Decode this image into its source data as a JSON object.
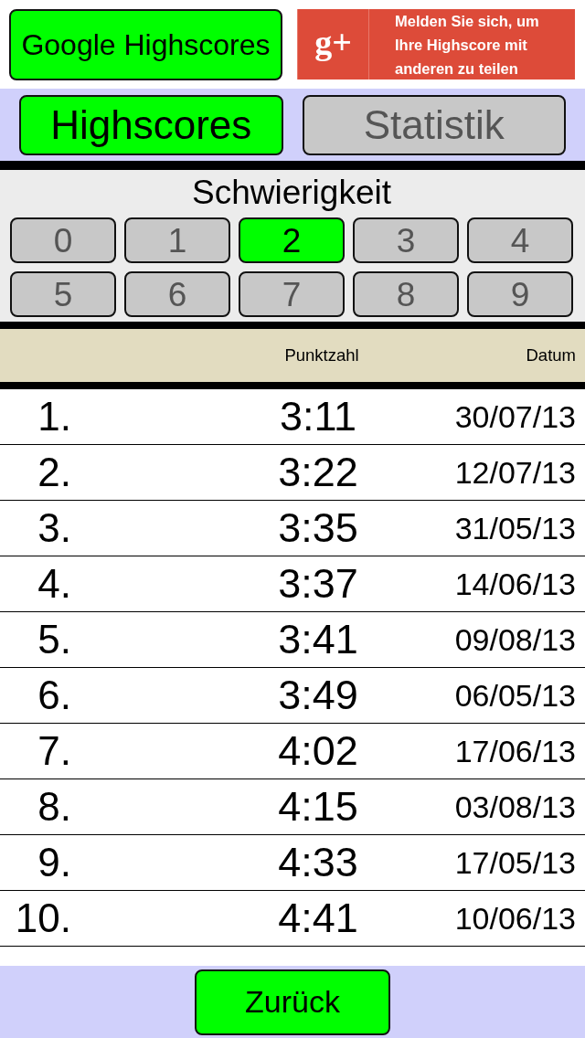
{
  "top_bar": {
    "google_button": "Google Highscores",
    "signin_banner": {
      "logo": "g+",
      "text": "Melden Sie sich, um Ihre Highscore mit anderen zu teilen"
    }
  },
  "tabs": [
    {
      "label": "Highscores",
      "selected": true
    },
    {
      "label": "Statistik",
      "selected": false
    }
  ],
  "difficulty": {
    "title": "Schwierigkeit",
    "levels": [
      {
        "label": "0",
        "selected": false
      },
      {
        "label": "1",
        "selected": false
      },
      {
        "label": "2",
        "selected": true
      },
      {
        "label": "3",
        "selected": false
      },
      {
        "label": "4",
        "selected": false
      },
      {
        "label": "5",
        "selected": false
      },
      {
        "label": "6",
        "selected": false
      },
      {
        "label": "7",
        "selected": false
      },
      {
        "label": "8",
        "selected": false
      },
      {
        "label": "9",
        "selected": false
      }
    ]
  },
  "table": {
    "columns": [
      "Punktzahl",
      "Datum"
    ],
    "rows": [
      {
        "rank": "1.",
        "score": "3:11",
        "date": "30/07/13"
      },
      {
        "rank": "2.",
        "score": "3:22",
        "date": "12/07/13"
      },
      {
        "rank": "3.",
        "score": "3:35",
        "date": "31/05/13"
      },
      {
        "rank": "4.",
        "score": "3:37",
        "date": "14/06/13"
      },
      {
        "rank": "5.",
        "score": "3:41",
        "date": "09/08/13"
      },
      {
        "rank": "6.",
        "score": "3:49",
        "date": "06/05/13"
      },
      {
        "rank": "7.",
        "score": "4:02",
        "date": "17/06/13"
      },
      {
        "rank": "8.",
        "score": "4:15",
        "date": "03/08/13"
      },
      {
        "rank": "9.",
        "score": "4:33",
        "date": "17/05/13"
      },
      {
        "rank": "10.",
        "score": "4:41",
        "date": "10/06/13"
      }
    ]
  },
  "back_button": "Zurück"
}
